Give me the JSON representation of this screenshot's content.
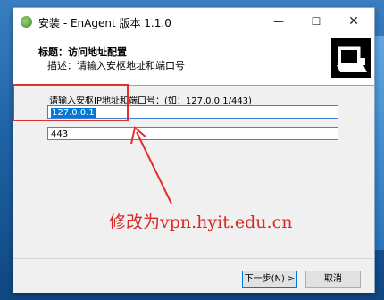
{
  "window": {
    "title": "安装 - EnAgent 版本 1.1.0",
    "minimize": "—",
    "maximize": "☐",
    "close": "✕"
  },
  "header": {
    "title": "标题：访问地址配置",
    "description": "描述：请输入安枢地址和端口号"
  },
  "form": {
    "prompt": "请输入安枢IP地址和端口号：(如：127.0.0.1/443)",
    "ip_value": "127.0.0.1",
    "port_value": "443"
  },
  "annotation": {
    "text": "修改为vpn.hyit.edu.cn",
    "color": "#d92a25"
  },
  "buttons": {
    "next": "下一步(N) >",
    "cancel": "取消"
  },
  "icons": {
    "app": "installer-app-icon",
    "header_logo": "installer-box-icon"
  }
}
